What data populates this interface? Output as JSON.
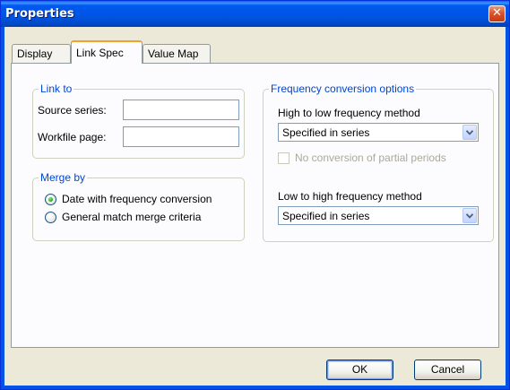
{
  "window": {
    "title": "Properties",
    "close_glyph": "✕"
  },
  "tabs": [
    {
      "label": "Display",
      "active": false
    },
    {
      "label": "Link Spec",
      "active": true
    },
    {
      "label": "Value Map",
      "active": false
    }
  ],
  "link_to": {
    "legend": "Link to",
    "source_series_label": "Source series:",
    "source_series_value": "",
    "workfile_page_label": "Workfile page:",
    "workfile_page_value": ""
  },
  "merge_by": {
    "legend": "Merge by",
    "options": [
      {
        "label": "Date with frequency conversion",
        "selected": true
      },
      {
        "label": "General match merge criteria",
        "selected": false
      }
    ]
  },
  "frequency": {
    "legend": "Frequency conversion options",
    "high_to_low_label": "High to low frequency method",
    "high_to_low_value": "Specified in series",
    "no_partial_label": "No conversion of partial periods",
    "no_partial_checked": false,
    "low_to_high_label": "Low to high frequency method",
    "low_to_high_value": "Specified in series"
  },
  "buttons": {
    "ok": "OK",
    "cancel": "Cancel"
  },
  "icons": {
    "close": "close-icon",
    "dropdown": "chevron-down-icon"
  },
  "colors": {
    "titlebar": "#0054e3",
    "legend_text": "#0046d5",
    "dialog_bg": "#ece9d8",
    "tab_highlight": "#f1a22a"
  }
}
